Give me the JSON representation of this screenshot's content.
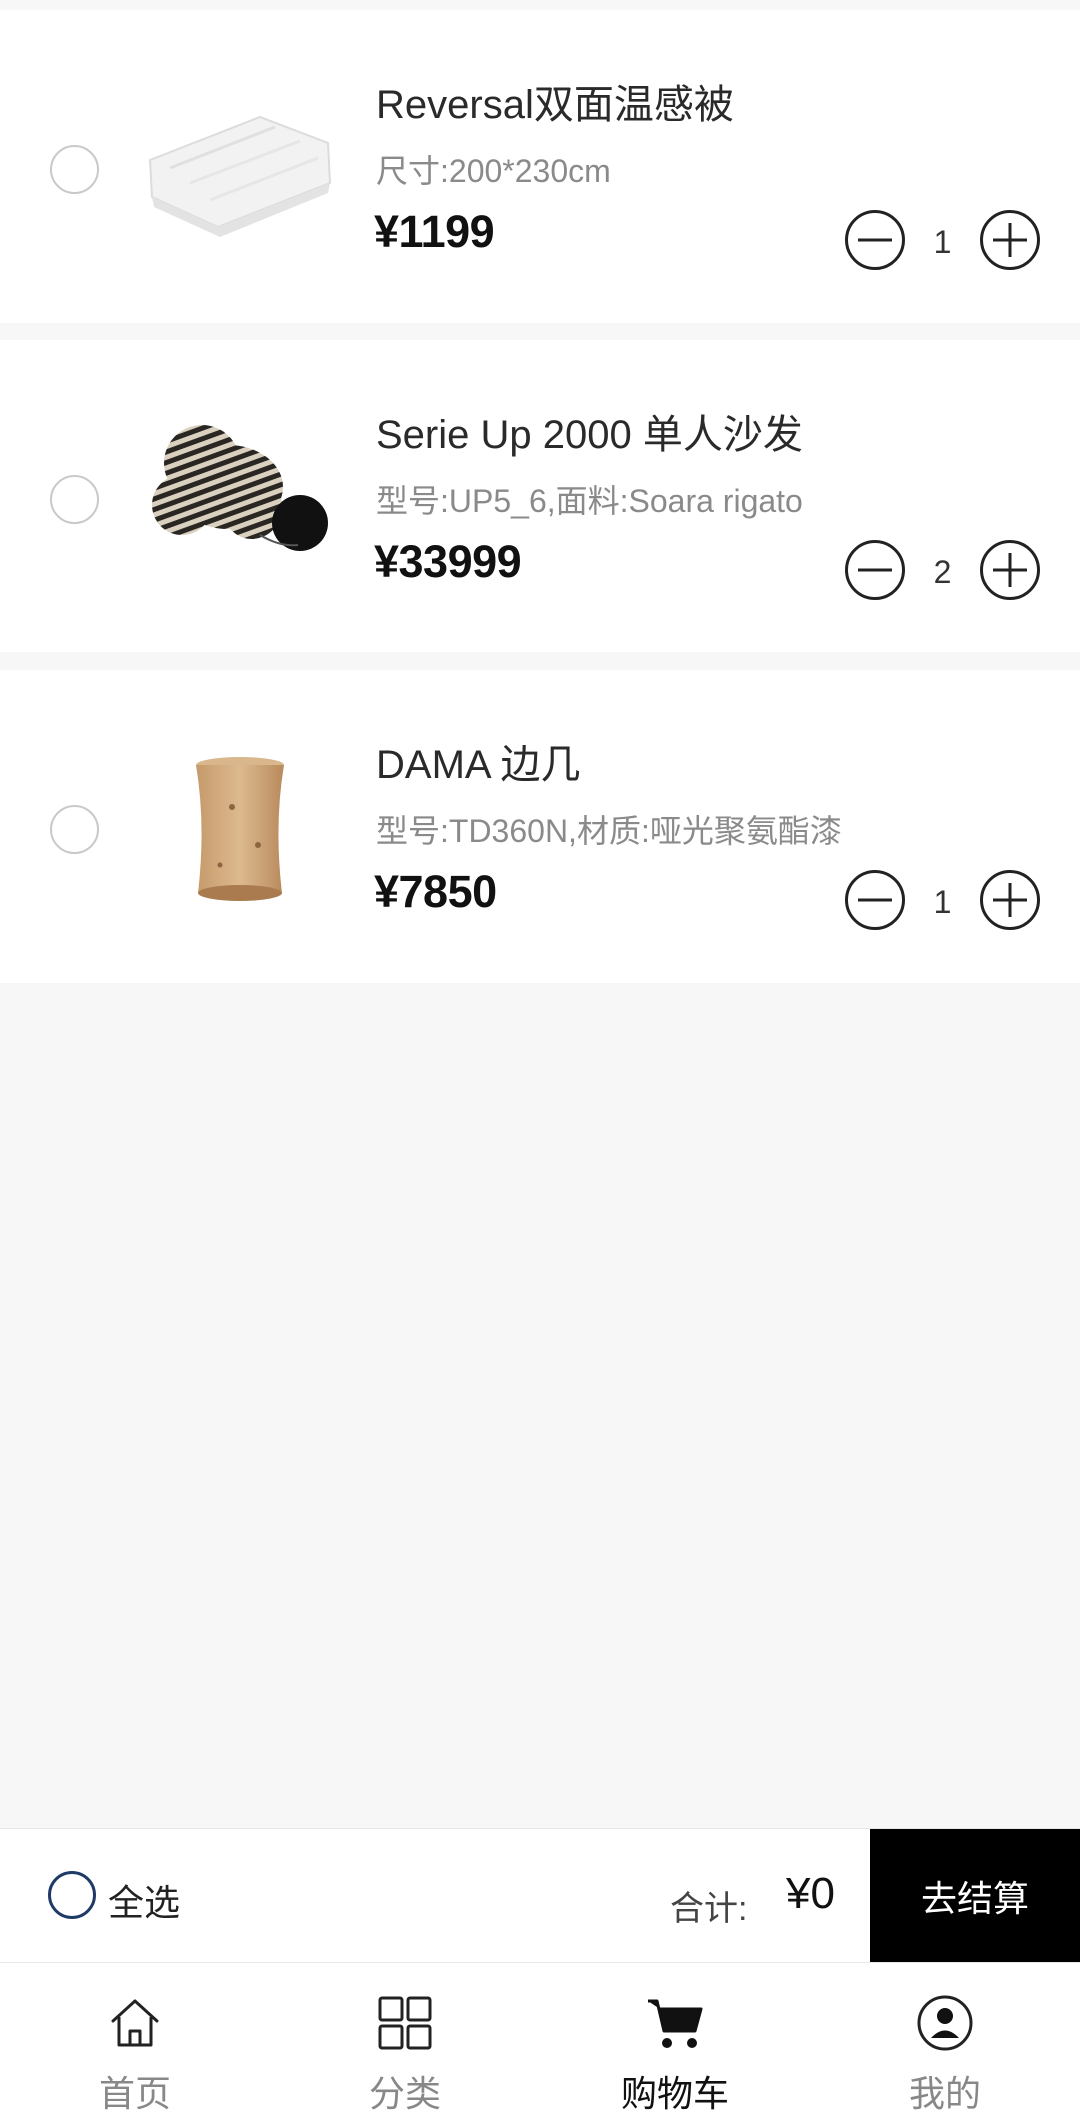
{
  "cart": {
    "items": [
      {
        "name": "Reversal双面温感被",
        "spec": "尺寸:200*230cm",
        "price": "¥1199",
        "quantity": "1",
        "image_icon": "folded-duvet-image"
      },
      {
        "name": "Serie Up 2000 单人沙发",
        "spec": "型号:UP5_6,面料:Soara rigato",
        "price": "¥33999",
        "quantity": "2",
        "image_icon": "striped-armchair-image"
      },
      {
        "name": "DAMA 边几",
        "spec": "型号:TD360N,材质:哑光聚氨酯漆",
        "price": "¥7850",
        "quantity": "1",
        "image_icon": "wooden-side-table-image"
      }
    ]
  },
  "bottom_bar": {
    "select_all_label": "全选",
    "total_label": "合计:",
    "total_value": "¥0",
    "checkout_label": "去结算"
  },
  "tab_bar": {
    "tabs": [
      {
        "label": "首页",
        "icon": "home-icon",
        "active": false
      },
      {
        "label": "分类",
        "icon": "category-grid-icon",
        "active": false
      },
      {
        "label": "购物车",
        "icon": "cart-icon",
        "active": true
      },
      {
        "label": "我的",
        "icon": "user-icon",
        "active": false
      }
    ]
  },
  "colors": {
    "background": "#f7f7f7",
    "card": "#ffffff",
    "checkout_bg": "#000000",
    "select_ring": "#1e3a66",
    "muted_text": "#888888"
  }
}
